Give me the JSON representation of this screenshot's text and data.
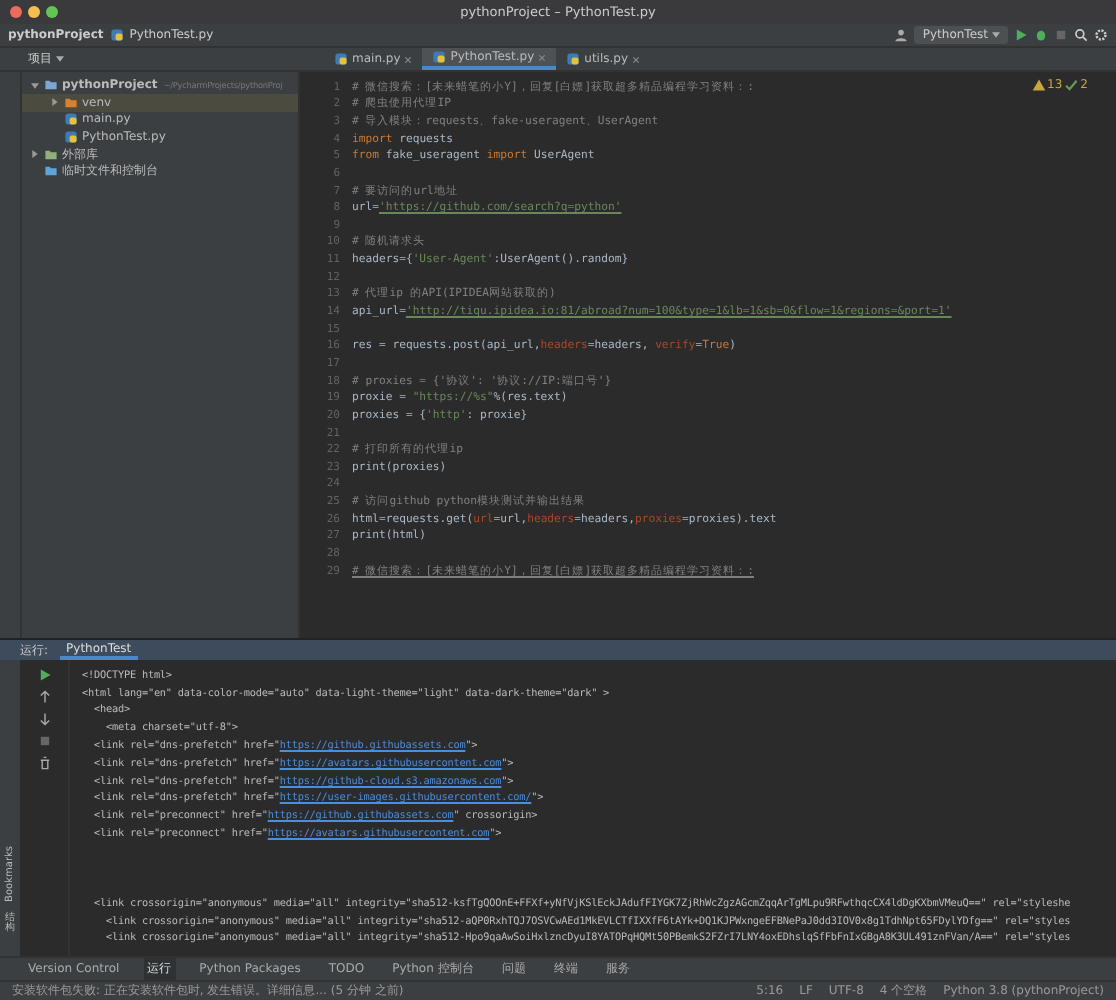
{
  "window": {
    "title": "pythonProject – PythonTest.py"
  },
  "nav": {
    "project": "pythonProject",
    "file": "PythonTest.py",
    "run_config": "PythonTest"
  },
  "project_panel": {
    "title": "项目",
    "tree": [
      {
        "label": "pythonProject",
        "hint": "~/PycharmProjects/pythonProj",
        "kind": "folder",
        "expanded": true,
        "selected": false,
        "children": [
          {
            "label": "venv",
            "kind": "venv",
            "expanded": false,
            "selected": true
          },
          {
            "label": "main.py",
            "kind": "py",
            "selected": false
          },
          {
            "label": "PythonTest.py",
            "kind": "py",
            "selected": false
          }
        ]
      },
      {
        "label": "外部库",
        "kind": "lib",
        "expanded": false,
        "selected": false
      },
      {
        "label": "临时文件和控制台",
        "kind": "scratch",
        "selected": false
      }
    ]
  },
  "tabs": [
    {
      "label": "main.py",
      "selected": false
    },
    {
      "label": "PythonTest.py",
      "selected": true
    },
    {
      "label": "utils.py",
      "selected": false
    }
  ],
  "inspections": {
    "warnings": "13",
    "ok": "2"
  },
  "editor": {
    "lines": [
      {
        "no": "1",
        "tokens": [
          {
            "t": "# 微信搜索：[未来蜡笔的小Y]，回复[白嫖]获取超多精品编程学习资料：:",
            "kind": "comment"
          }
        ]
      },
      {
        "no": "2",
        "tokens": [
          {
            "t": "# 爬虫使用代理IP",
            "kind": "comment"
          }
        ]
      },
      {
        "no": "3",
        "tokens": [
          {
            "t": "# 导入模块：requests、fake-useragent、UserAgent",
            "kind": "comment"
          }
        ]
      },
      {
        "no": "4",
        "tokens": [
          {
            "t": "import",
            "kind": "keyword"
          },
          {
            "t": " requests",
            "kind": "plain"
          }
        ]
      },
      {
        "no": "5",
        "tokens": [
          {
            "t": "from",
            "kind": "keyword"
          },
          {
            "t": " fake_useragent ",
            "kind": "plain"
          },
          {
            "t": "import",
            "kind": "keyword"
          },
          {
            "t": " UserAgent",
            "kind": "plain"
          }
        ]
      },
      {
        "no": "6"
      },
      {
        "no": "7",
        "tokens": [
          {
            "t": "# 要访问的url地址",
            "kind": "comment"
          }
        ]
      },
      {
        "no": "8",
        "tokens": [
          {
            "t": "url=",
            "kind": "plain"
          },
          {
            "t": "'https://github.com/search?q=python'",
            "kind": "url"
          }
        ]
      },
      {
        "no": "9"
      },
      {
        "no": "10",
        "tokens": [
          {
            "t": "# 随机请求头",
            "kind": "comment"
          }
        ]
      },
      {
        "no": "11",
        "tokens": [
          {
            "t": "headers={",
            "kind": "plain"
          },
          {
            "t": "'User-Agent'",
            "kind": "string"
          },
          {
            "t": ":UserAgent().random}",
            "kind": "plain"
          }
        ]
      },
      {
        "no": "12"
      },
      {
        "no": "13",
        "tokens": [
          {
            "t": "# 代理ip 的API(IPIDEA网站获取的)",
            "kind": "comment"
          }
        ]
      },
      {
        "no": "14",
        "tokens": [
          {
            "t": "api_url=",
            "kind": "plain"
          },
          {
            "t": "'http://tiqu.ipidea.io:81/abroad?num=100&type=1&lb=1&sb=0&flow=1&regions=&port=1'",
            "kind": "url"
          }
        ]
      },
      {
        "no": "15"
      },
      {
        "no": "16",
        "tokens": [
          {
            "t": "res = requests.post(api_url,",
            "kind": "plain"
          },
          {
            "t": "headers",
            "kind": "param"
          },
          {
            "t": "=headers, ",
            "kind": "plain"
          },
          {
            "t": "verify",
            "kind": "param"
          },
          {
            "t": "=",
            "kind": "plain"
          },
          {
            "t": "True",
            "kind": "keyword"
          },
          {
            "t": ")",
            "kind": "plain"
          }
        ]
      },
      {
        "no": "17"
      },
      {
        "no": "18",
        "tokens": [
          {
            "t": "# proxies = {'协议': '协议://IP:端口号'}",
            "kind": "comment"
          }
        ]
      },
      {
        "no": "19",
        "tokens": [
          {
            "t": "proxie = ",
            "kind": "plain"
          },
          {
            "t": "\"https://%s\"",
            "kind": "string"
          },
          {
            "t": "%(res.text)",
            "kind": "plain"
          }
        ]
      },
      {
        "no": "20",
        "tokens": [
          {
            "t": "proxies = {",
            "kind": "plain"
          },
          {
            "t": "'http'",
            "kind": "string"
          },
          {
            "t": ": proxie}",
            "kind": "plain"
          }
        ]
      },
      {
        "no": "21"
      },
      {
        "no": "22",
        "tokens": [
          {
            "t": "# 打印所有的代理ip",
            "kind": "comment"
          }
        ]
      },
      {
        "no": "23",
        "tokens": [
          {
            "t": "print(proxies)",
            "kind": "plain"
          }
        ]
      },
      {
        "no": "24"
      },
      {
        "no": "25",
        "tokens": [
          {
            "t": "# 访问github python模块测试并输出结果",
            "kind": "comment"
          }
        ]
      },
      {
        "no": "26",
        "tokens": [
          {
            "t": "html=requests.get(",
            "kind": "plain"
          },
          {
            "t": "url",
            "kind": "param"
          },
          {
            "t": "=url,",
            "kind": "plain"
          },
          {
            "t": "headers",
            "kind": "param"
          },
          {
            "t": "=headers,",
            "kind": "plain"
          },
          {
            "t": "proxies",
            "kind": "param"
          },
          {
            "t": "=proxies).text",
            "kind": "plain"
          }
        ]
      },
      {
        "no": "27",
        "tokens": [
          {
            "t": "print(html)",
            "kind": "plain"
          }
        ]
      },
      {
        "no": "28"
      },
      {
        "no": "29",
        "tokens": [
          {
            "t": "# 微信搜索：[未来蜡笔的小Y]，回复[白嫖]获取超多精品编程学习资料：:",
            "kind": "comment-link"
          }
        ]
      }
    ]
  },
  "run_panel": {
    "label": "运行:",
    "tab": "PythonTest",
    "output": [
      {
        "lines": [
          {
            "tokens": [
              {
                "t": "<!DOCTYPE html>",
                "kind": "plain"
              }
            ]
          },
          {
            "tokens": [
              {
                "t": "<html lang=\"en\" data-color-mode=\"auto\" data-light-theme=\"light\" data-dark-theme=\"dark\" >",
                "kind": "plain"
              }
            ]
          },
          {
            "tokens": [
              {
                "t": "  <head>",
                "kind": "plain"
              }
            ]
          },
          {
            "tokens": [
              {
                "t": "    <meta charset=\"utf-8\">",
                "kind": "plain"
              }
            ]
          },
          {
            "tokens": [
              {
                "t": "  <link rel=\"dns-prefetch\" href=\"",
                "kind": "plain"
              },
              {
                "t": "https://github.githubassets.com",
                "kind": "url"
              },
              {
                "t": "\">",
                "kind": "plain"
              }
            ]
          },
          {
            "tokens": [
              {
                "t": "  <link rel=\"dns-prefetch\" href=\"",
                "kind": "plain"
              },
              {
                "t": "https://avatars.githubusercontent.com",
                "kind": "url"
              },
              {
                "t": "\">",
                "kind": "plain"
              }
            ]
          },
          {
            "tokens": [
              {
                "t": "  <link rel=\"dns-prefetch\" href=\"",
                "kind": "plain"
              },
              {
                "t": "https://github-cloud.s3.amazonaws.com",
                "kind": "url"
              },
              {
                "t": "\">",
                "kind": "plain"
              }
            ]
          },
          {
            "tokens": [
              {
                "t": "  <link rel=\"dns-prefetch\" href=\"",
                "kind": "plain"
              },
              {
                "t": "https://user-images.githubusercontent.com/",
                "kind": "url"
              },
              {
                "t": "\">",
                "kind": "plain"
              }
            ]
          },
          {
            "tokens": [
              {
                "t": "  <link rel=\"preconnect\" href=\"",
                "kind": "plain"
              },
              {
                "t": "https://github.githubassets.com",
                "kind": "url"
              },
              {
                "t": "\" crossorigin>",
                "kind": "plain"
              }
            ]
          },
          {
            "tokens": [
              {
                "t": "  <link rel=\"preconnect\" href=\"",
                "kind": "plain"
              },
              {
                "t": "https://avatars.githubusercontent.com",
                "kind": "url"
              },
              {
                "t": "\">",
                "kind": "plain"
              }
            ]
          }
        ]
      },
      {
        "lines": [
          {
            "tokens": [
              {
                "t": "  <link crossorigin=\"anonymous\" media=\"all\" integrity=\"sha512-ksfTgQOOnE+FFXf+yNfVjKSlEckJAdufFIYGK7ZjRhWcZgzAGcmZqqArTgMLpu9RFwthqcCX4ldDgKXbmVMeuQ==\" rel=\"styleshe",
                "kind": "plain"
              }
            ]
          },
          {
            "tokens": [
              {
                "t": "    <link crossorigin=\"anonymous\" media=\"all\" integrity=\"sha512-aQP0RxhTQJ7OSVCwAEd1MkEVLCTfIXXfF6tAYk+DQ1KJPWxngeEFBNePaJ0dd3IOV0x8g1TdhNpt65FDylYDfg==\" rel=\"styles",
                "kind": "plain"
              }
            ]
          },
          {
            "tokens": [
              {
                "t": "    <link crossorigin=\"anonymous\" media=\"all\" integrity=\"sha512-Hpo9qaAwSoiHxlzncDyuI8YATOPqHQMt50PBemkS2FZrI7LNY4oxEDhslqSfFbFnIxGBgA8K3UL491znFVan/A==\" rel=\"styles",
                "kind": "plain"
              }
            ]
          }
        ]
      }
    ]
  },
  "side_labels": [
    "Bookmarks",
    "结构"
  ],
  "tool_windows": [
    {
      "label": "Version Control",
      "selected": false
    },
    {
      "label": "运行",
      "selected": true
    },
    {
      "label": "Python Packages",
      "selected": false
    },
    {
      "label": "TODO",
      "selected": false
    },
    {
      "label": "Python 控制台",
      "selected": false
    },
    {
      "label": "问题",
      "selected": false
    },
    {
      "label": "终端",
      "selected": false
    },
    {
      "label": "服务",
      "selected": false
    }
  ],
  "status_bar": {
    "message": "安装软件包失败: 正在安装软件包时, 发生错误。详细信息... (5 分钟 之前)",
    "items": [
      "5:16",
      "LF",
      "UTF-8",
      "4 个空格",
      "Python 3.8 (pythonProject)"
    ]
  }
}
